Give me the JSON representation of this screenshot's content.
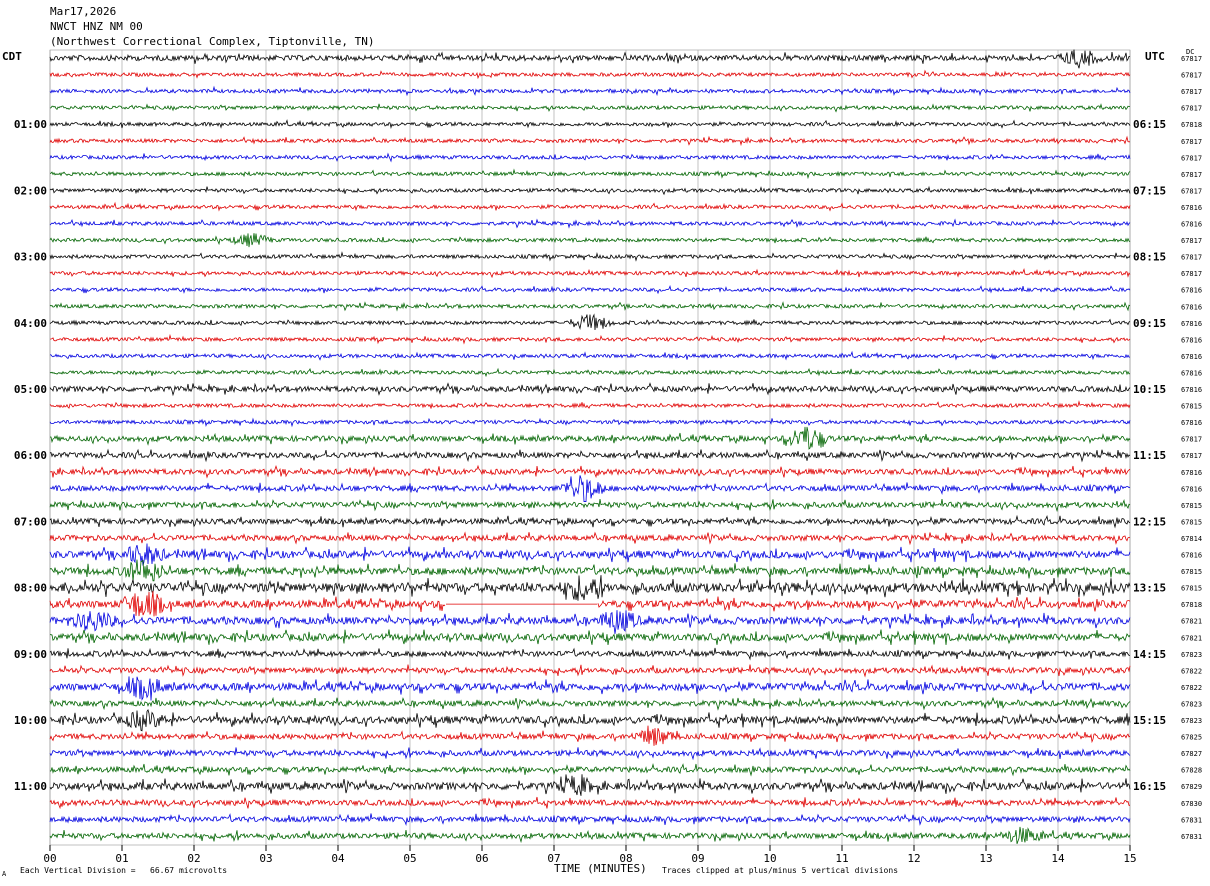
{
  "header": {
    "date": "Mar17,2026",
    "station": "NWCT HNZ NM 00",
    "location": "(Northwest Correctional Complex, Tiptonville, TN)"
  },
  "labels": {
    "left_tz": "CDT",
    "right_tz": "UTC",
    "dc": "DC"
  },
  "footer": {
    "scale": "Each Vertical Division =   66.67 microvolts",
    "clip": "Traces clipped at plus/minus 5 vertical divisions",
    "mark": "A"
  },
  "chart_data": {
    "type": "line",
    "title": "",
    "xlabel": "TIME (MINUTES)",
    "xlim": [
      0,
      15
    ],
    "xticks": [
      "00",
      "01",
      "02",
      "03",
      "04",
      "05",
      "06",
      "07",
      "08",
      "09",
      "10",
      "11",
      "12",
      "13",
      "14",
      "15"
    ],
    "trace_colors": [
      "#000000",
      "#e00000",
      "#0000e0",
      "#006400"
    ],
    "minutes_per_trace": 15,
    "left_hour_labels": [
      "01:00",
      "02:00",
      "03:00",
      "04:00",
      "05:00",
      "06:00",
      "07:00",
      "08:00",
      "09:00",
      "10:00",
      "11:00"
    ],
    "right_hour_labels": [
      "06:15",
      "07:15",
      "08:15",
      "09:15",
      "10:15",
      "11:15",
      "12:15",
      "13:15",
      "14:15",
      "15:15",
      "16:15"
    ],
    "dc_values": [
      "67817",
      "67817",
      "67817",
      "67817",
      "67818",
      "67817",
      "67817",
      "67817",
      "67817",
      "67816",
      "67816",
      "67817",
      "67817",
      "67817",
      "67816",
      "67816",
      "67816",
      "67816",
      "67816",
      "67816",
      "67816",
      "67815",
      "67816",
      "67817",
      "67817",
      "67816",
      "67816",
      "67815",
      "67815",
      "67814",
      "67816",
      "67815",
      "67815",
      "67818",
      "67821",
      "67821",
      "67823",
      "67822",
      "67822",
      "67823",
      "67823",
      "67825",
      "67827",
      "67828",
      "67829",
      "67830",
      "67831",
      "67831"
    ],
    "activity": [
      2,
      1,
      1,
      1,
      1,
      1,
      1,
      1,
      1,
      1,
      1,
      1,
      1,
      1,
      1,
      1,
      1,
      1,
      1,
      1,
      2,
      1,
      1,
      2,
      2,
      2,
      2,
      2,
      2,
      2,
      3,
      3,
      4,
      3,
      3,
      3,
      2,
      2,
      3,
      2,
      3,
      2,
      2,
      2,
      3,
      2,
      2,
      2
    ],
    "events": [
      {
        "trace": 0,
        "minute": 14.3,
        "amp": 2.0
      },
      {
        "trace": 11,
        "minute": 2.8,
        "amp": 1.5
      },
      {
        "trace": 16,
        "minute": 7.5,
        "amp": 2.0
      },
      {
        "trace": 23,
        "minute": 10.5,
        "amp": 3.0
      },
      {
        "trace": 26,
        "minute": 7.4,
        "amp": 3.5
      },
      {
        "trace": 30,
        "minute": 1.3,
        "amp": 2.5
      },
      {
        "trace": 31,
        "minute": 1.3,
        "amp": 3.0
      },
      {
        "trace": 32,
        "minute": 7.4,
        "amp": 3.0
      },
      {
        "trace": 33,
        "minute": 1.3,
        "amp": 4.0
      },
      {
        "trace": 34,
        "minute": 0.6,
        "amp": 2.5
      },
      {
        "trace": 34,
        "minute": 7.9,
        "amp": 2.5
      },
      {
        "trace": 38,
        "minute": 1.3,
        "amp": 2.5
      },
      {
        "trace": 40,
        "minute": 1.3,
        "amp": 2.0
      },
      {
        "trace": 41,
        "minute": 8.4,
        "amp": 2.0
      },
      {
        "trace": 44,
        "minute": 7.3,
        "amp": 2.0
      },
      {
        "trace": 47,
        "minute": 13.5,
        "amp": 1.8
      }
    ],
    "gaps": [
      {
        "trace": 33,
        "from": 5.5,
        "to": 7.6
      }
    ]
  }
}
